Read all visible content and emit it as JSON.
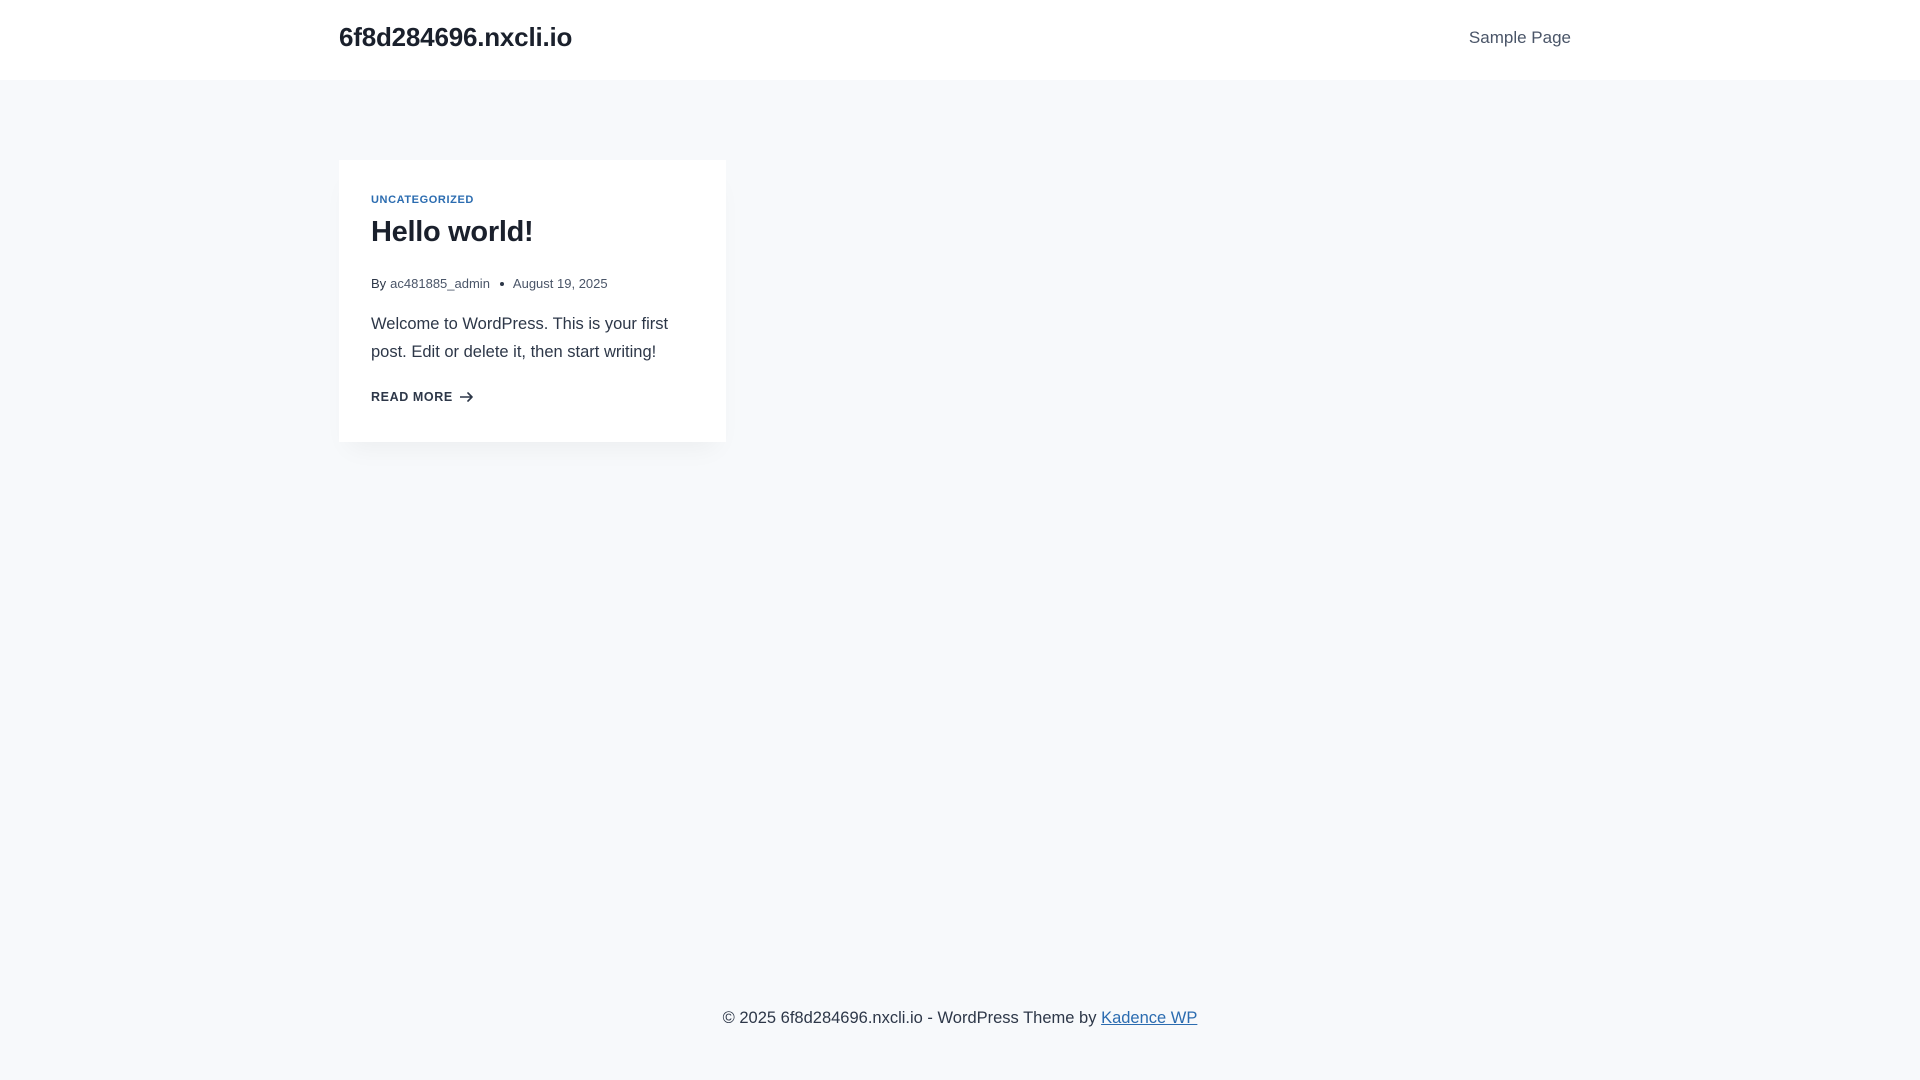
{
  "header": {
    "site_title": "6f8d284696.nxcli.io",
    "nav": [
      {
        "label": "Sample Page"
      }
    ]
  },
  "posts": [
    {
      "category": "UNCATEGORIZED",
      "title": "Hello world!",
      "byline_prefix": "By",
      "author": "ac481885_admin",
      "date": "August 19, 2025",
      "excerpt": "Welcome to WordPress. This is your first post. Edit or delete it, then start writing!",
      "read_more_label": "READ MORE",
      "read_more_icon": "arrow-right-icon"
    }
  ],
  "footer": {
    "text": "© 2025 6f8d284696.nxcli.io - WordPress Theme by",
    "link_label": "Kadence WP"
  },
  "colors": {
    "page_background": "#f7f9fb",
    "accent": "#2b6cb0",
    "heading": "#1a202c",
    "body_text": "#2d3748"
  }
}
